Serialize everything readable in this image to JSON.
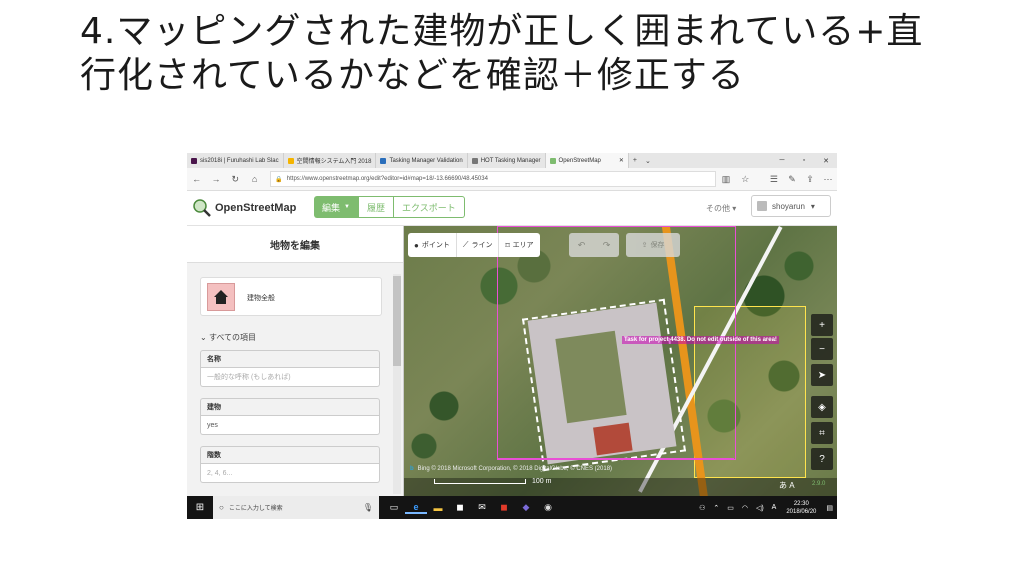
{
  "slide": {
    "title": "4.マッピングされた建物が正しく囲まれている+直行化されているかなどを確認＋修正する"
  },
  "browser": {
    "tabs": [
      {
        "label": "sis2018i | Furuhashi Lab Slac",
        "icon": "slack-icon",
        "color": "#4a154b"
      },
      {
        "label": "空間情報システム入門 2018",
        "icon": "drive-icon",
        "color": "#f4b400"
      },
      {
        "label": "Tasking Manager Validation",
        "icon": "hot-icon",
        "color": "#2a6ebb"
      },
      {
        "label": "HOT Tasking Manager",
        "icon": "page-icon",
        "color": "#777777"
      },
      {
        "label": "OpenStreetMap",
        "icon": "osm-icon",
        "color": "#7ebc6f"
      }
    ],
    "url": "https://www.openstreetmap.org/edit?editor=id#map=18/-13.66690/48.45034"
  },
  "osm": {
    "logo_text": "OpenStreetMap",
    "nav": {
      "edit": "編集",
      "history": "履歴",
      "export": "エクスポート"
    },
    "other": "その他",
    "user": "shoyarun"
  },
  "sidebar": {
    "title": "地物を編集",
    "preset_name": "建物全般",
    "all_fields": "すべての項目",
    "fields": [
      {
        "label": "名称",
        "value": "一般的な呼称 (もしあれば)",
        "placeholder": true
      },
      {
        "label": "建物",
        "value": "yes",
        "placeholder": false
      },
      {
        "label": "階数",
        "value": "2, 4, 6...",
        "placeholder": true
      }
    ]
  },
  "map": {
    "tools": {
      "point": "ポイント",
      "line": "ライン",
      "area": "エリア"
    },
    "save": "保存",
    "task_warning": "Task for project 4438. Do not edit outside of this area!",
    "attribution": "Bing  © 2018 Microsoft Corporation, © 2018 DigitalGlobe, © CNES (2018)",
    "scale": "100 m",
    "version": "2.9.0"
  },
  "taskbar": {
    "search_placeholder": "ここに入力して検索",
    "time": "22:30",
    "date": "2018/06/20"
  }
}
